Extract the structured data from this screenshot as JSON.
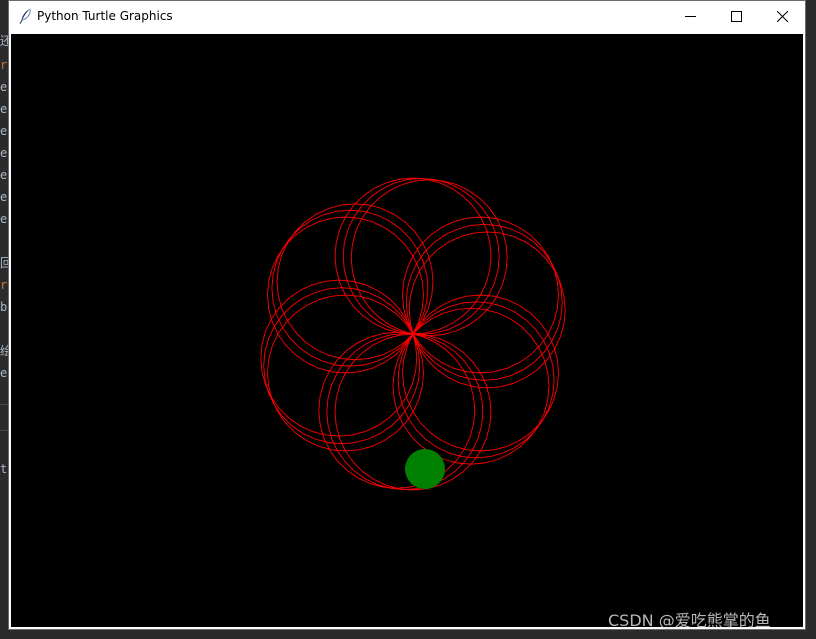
{
  "window": {
    "title": "Python Turtle Graphics",
    "icon": "feather-icon",
    "buttons": [
      "minimize-icon",
      "maximize-icon",
      "close-icon"
    ]
  },
  "canvas": {
    "background": "#000000",
    "pattern": {
      "stroke_color": "#ff0000",
      "loops": 6,
      "copies_per_loop": 3
    },
    "turtle_dot": {
      "color": "#008000"
    }
  },
  "background_editor": {
    "gutter_chars": [
      "还",
      "r",
      "e",
      "e",
      "e",
      "e",
      "e",
      "e",
      "e",
      "回",
      "r",
      "b",
      "绘",
      "e",
      "t"
    ]
  },
  "watermark": {
    "text": "CSDN @爱吃熊掌的鱼"
  },
  "colors": {
    "titlebar": "#ffffff",
    "window_border": "#6b6b6b"
  }
}
